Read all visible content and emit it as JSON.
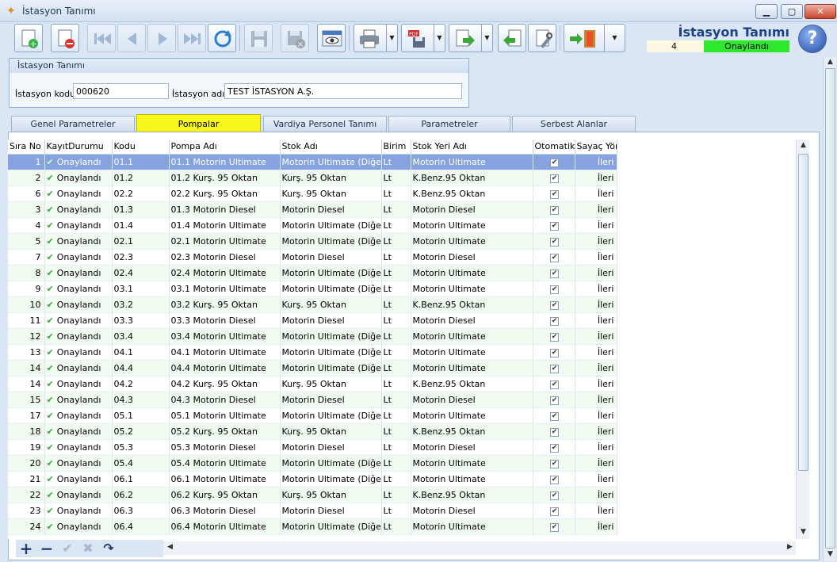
{
  "window": {
    "title": "İstasyon Tanımı"
  },
  "header": {
    "title": "İstasyon Tanımı",
    "record_number": "4",
    "status": "Onaylandı"
  },
  "toolbar_icons": [
    "new-record-icon",
    "delete-record-icon",
    "first-record-icon",
    "previous-record-icon",
    "next-record-icon",
    "last-record-icon",
    "refresh-icon",
    "save-icon",
    "cancel-save-icon",
    "preview-icon",
    "print-icon",
    "pdf-export-icon",
    "export-icon",
    "import-icon",
    "settings-icon",
    "exit-icon",
    "help-icon"
  ],
  "form": {
    "group_title": "İstasyon Tanımı",
    "code_label": "İstasyon kodu",
    "code_value": "000620",
    "name_label": "İstasyon adı",
    "name_value": "TEST İSTASYON A.Ş."
  },
  "tabs": [
    {
      "label": "Genel Parametreler"
    },
    {
      "label": "Pompalar"
    },
    {
      "label": "Vardiya Personel Tanımı"
    },
    {
      "label": "Parametreler"
    },
    {
      "label": "Serbest Alanlar"
    }
  ],
  "table": {
    "columns": [
      "Sıra No",
      "KayıtDurumu",
      "Kodu",
      "Pompa Adı",
      "Stok Adı",
      "Birim",
      "Stok Yeri Adı",
      "Otomatik",
      "Sayaç Yönü"
    ],
    "rows": [
      [
        "1",
        "Onaylandı",
        "01.1",
        "01.1 Motorin Ultimate",
        "Motorin Ultimate (Diğer)",
        "Lt",
        "Motorin Ultimate",
        "İleri"
      ],
      [
        "2",
        "Onaylandı",
        "01.2",
        "01.2 Kurş. 95 Oktan",
        "Kurş. 95 Oktan",
        "Lt",
        "K.Benz.95 Oktan",
        "İleri"
      ],
      [
        "6",
        "Onaylandı",
        "02.2",
        "02.2 Kurş. 95 Oktan",
        "Kurş. 95 Oktan",
        "Lt",
        "K.Benz.95 Oktan",
        "İleri"
      ],
      [
        "3",
        "Onaylandı",
        "01.3",
        "01.3 Motorin Diesel",
        "Motorin Diesel",
        "Lt",
        "Motorin Diesel",
        "İleri"
      ],
      [
        "4",
        "Onaylandı",
        "01.4",
        "01.4 Motorin Ultimate",
        "Motorin Ultimate (Diğer)",
        "Lt",
        "Motorin Ultimate",
        "İleri"
      ],
      [
        "5",
        "Onaylandı",
        "02.1",
        "02.1 Motorin Ultimate",
        "Motorin Ultimate (Diğer)",
        "Lt",
        "Motorin Ultimate",
        "İleri"
      ],
      [
        "7",
        "Onaylandı",
        "02.3",
        "02.3 Motorin Diesel",
        "Motorin Diesel",
        "Lt",
        "Motorin Diesel",
        "İleri"
      ],
      [
        "8",
        "Onaylandı",
        "02.4",
        "02.4 Motorin Ultimate",
        "Motorin Ultimate (Diğer)",
        "Lt",
        "Motorin Ultimate",
        "İleri"
      ],
      [
        "9",
        "Onaylandı",
        "03.1",
        "03.1 Motorin Ultimate",
        "Motorin Ultimate (Diğer)",
        "Lt",
        "Motorin Ultimate",
        "İleri"
      ],
      [
        "10",
        "Onaylandı",
        "03.2",
        "03.2 Kurş. 95 Oktan",
        "Kurş. 95 Oktan",
        "Lt",
        "K.Benz.95 Oktan",
        "İleri"
      ],
      [
        "11",
        "Onaylandı",
        "03.3",
        "03.3 Motorin Diesel",
        "Motorin Diesel",
        "Lt",
        "Motorin Diesel",
        "İleri"
      ],
      [
        "12",
        "Onaylandı",
        "03.4",
        "03.4 Motorin Ultimate",
        "Motorin Ultimate (Diğer)",
        "Lt",
        "Motorin Ultimate",
        "İleri"
      ],
      [
        "13",
        "Onaylandı",
        "04.1",
        "04.1 Motorin Ultimate",
        "Motorin Ultimate (Diğer)",
        "Lt",
        "Motorin Ultimate",
        "İleri"
      ],
      [
        "14",
        "Onaylandı",
        "04.4",
        "04.4 Motorin Ultimate",
        "Motorin Ultimate (Diğer)",
        "Lt",
        "Motorin Ultimate",
        "İleri"
      ],
      [
        "14",
        "Onaylandı",
        "04.2",
        "04.2 Kurş. 95 Oktan",
        "Kurş. 95 Oktan",
        "Lt",
        "K.Benz.95 Oktan",
        "İleri"
      ],
      [
        "15",
        "Onaylandı",
        "04.3",
        "04.3 Motorin Diesel",
        "Motorin Diesel",
        "Lt",
        "Motorin Diesel",
        "İleri"
      ],
      [
        "17",
        "Onaylandı",
        "05.1",
        "05.1 Motorin Ultimate",
        "Motorin Ultimate (Diğer)",
        "Lt",
        "Motorin Ultimate",
        "İleri"
      ],
      [
        "18",
        "Onaylandı",
        "05.2",
        "05.2 Kurş. 95 Oktan",
        "Kurş. 95 Oktan",
        "Lt",
        "K.Benz.95 Oktan",
        "İleri"
      ],
      [
        "19",
        "Onaylandı",
        "05.3",
        "05.3 Motorin Diesel",
        "Motorin Diesel",
        "Lt",
        "Motorin Diesel",
        "İleri"
      ],
      [
        "20",
        "Onaylandı",
        "05.4",
        "05.4 Motorin Ultimate",
        "Motorin Ultimate (Diğer)",
        "Lt",
        "Motorin Ultimate",
        "İleri"
      ],
      [
        "21",
        "Onaylandı",
        "06.1",
        "06.1 Motorin Ultimate",
        "Motorin Ultimate (Diğer)",
        "Lt",
        "Motorin Ultimate",
        "İleri"
      ],
      [
        "22",
        "Onaylandı",
        "06.2",
        "06.2 Kurş. 95 Oktan",
        "Kurş. 95 Oktan",
        "Lt",
        "K.Benz.95 Oktan",
        "İleri"
      ],
      [
        "23",
        "Onaylandı",
        "06.3",
        "06.3 Motorin Diesel",
        "Motorin Diesel",
        "Lt",
        "Motorin Diesel",
        "İleri"
      ],
      [
        "24",
        "Onaylandı",
        "06.4",
        "06.4 Motorin Ultimate",
        "Motorin Ultimate (Diğer)",
        "Lt",
        "Motorin Ultimate",
        "İleri"
      ]
    ],
    "selected_row": 0
  },
  "colors": {
    "status_green": "#2ee82e",
    "active_tab": "#f7f719",
    "selected_row": "#87a3df",
    "alt_row": "#f1fbf0"
  },
  "navigator_icons": [
    "plus-icon",
    "minus-icon",
    "check-icon",
    "cancel-icon",
    "undo-icon"
  ]
}
